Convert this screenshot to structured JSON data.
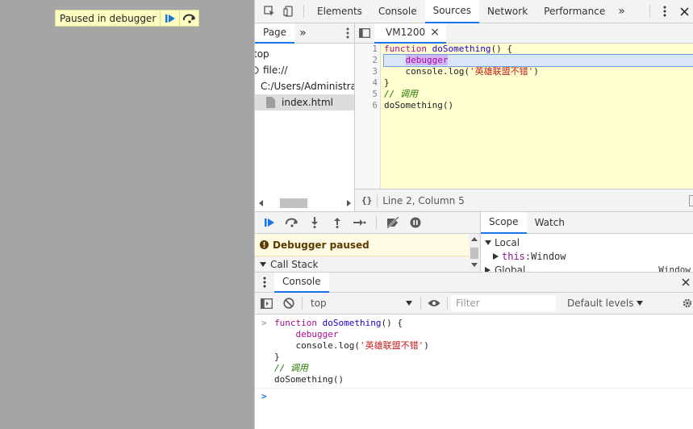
{
  "overlay": {
    "text": "Paused in debugger"
  },
  "main_tabs": [
    "Elements",
    "Console",
    "Sources",
    "Network",
    "Performance"
  ],
  "main_tabs_overflow": "»",
  "navigator": {
    "tab": "Page",
    "overflow": "»",
    "tree": [
      "top",
      "file://",
      "C:/Users/Administra",
      "index.html"
    ]
  },
  "editor": {
    "tab": "VM1200",
    "close_glyph": "×",
    "line_numbers": [
      "1",
      "2",
      "3",
      "4",
      "5",
      "6"
    ],
    "code": {
      "l1_kw": "function",
      "l1_fn": "doSomething",
      "l1_rest": "() {",
      "l2_indent": "    ",
      "l2_dbg": "debugger",
      "l3_pre": "    console.log(",
      "l3_str": "'英雄联盟不错'",
      "l3_post": ")",
      "l4": "}",
      "l5": "// 调用",
      "l6": "doSomething()"
    },
    "status_braces": "{}",
    "status": "Line 2, Column 5"
  },
  "debugger": {
    "paused": "Debugger paused",
    "callstack": "Call Stack"
  },
  "scope": {
    "tabs": [
      "Scope",
      "Watch"
    ],
    "local": "Local",
    "this_key": "this",
    "this_val": "Window",
    "global": "Global",
    "global_val": "Window"
  },
  "drawer": {
    "tab": "Console"
  },
  "console_toolbar": {
    "context": "top",
    "filter_placeholder": "Filter",
    "levels": "Default levels"
  },
  "console_output": {
    "l1_kw": "function",
    "l1_fn": "doSomething",
    "l1_rest": "() {",
    "l2_indent": "    ",
    "l2_dbg": "debugger",
    "l3_pre": "    console.log(",
    "l3_str": "'英雄联盟不错'",
    "l3_post": ")",
    "l4": "}",
    "l5": "// 调用",
    "l6": "doSomething()"
  },
  "colors": {
    "accent": "#1a73e8",
    "paused_bg": "#ffffc2",
    "code_bg": "#fffed0"
  }
}
